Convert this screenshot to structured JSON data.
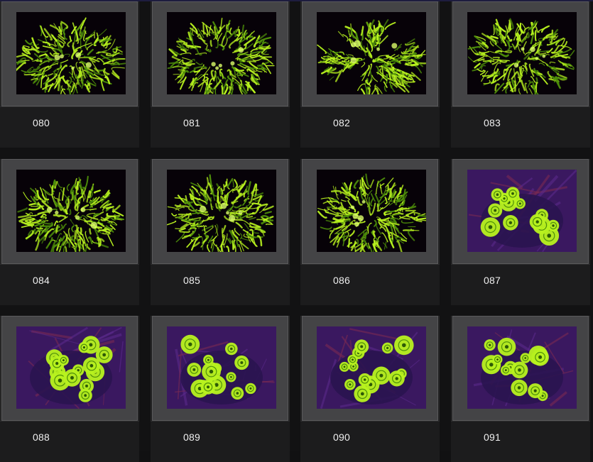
{
  "gallery": {
    "items": [
      {
        "label": "080",
        "subject": "polyp"
      },
      {
        "label": "081",
        "subject": "polyp"
      },
      {
        "label": "082",
        "subject": "polyp"
      },
      {
        "label": "083",
        "subject": "polyp"
      },
      {
        "label": "084",
        "subject": "polyp"
      },
      {
        "label": "085",
        "subject": "polyp"
      },
      {
        "label": "086",
        "subject": "polyp"
      },
      {
        "label": "087",
        "subject": "candy"
      },
      {
        "label": "088",
        "subject": "candy"
      },
      {
        "label": "089",
        "subject": "candy"
      },
      {
        "label": "090",
        "subject": "candy"
      },
      {
        "label": "091",
        "subject": "candy"
      }
    ]
  },
  "colors": {
    "coral_green": "#b8f21f",
    "coral_dark": "#4e8f0a",
    "photo_bg": "#070208",
    "purple_bg": "#3a1860",
    "frame": "#444446"
  }
}
